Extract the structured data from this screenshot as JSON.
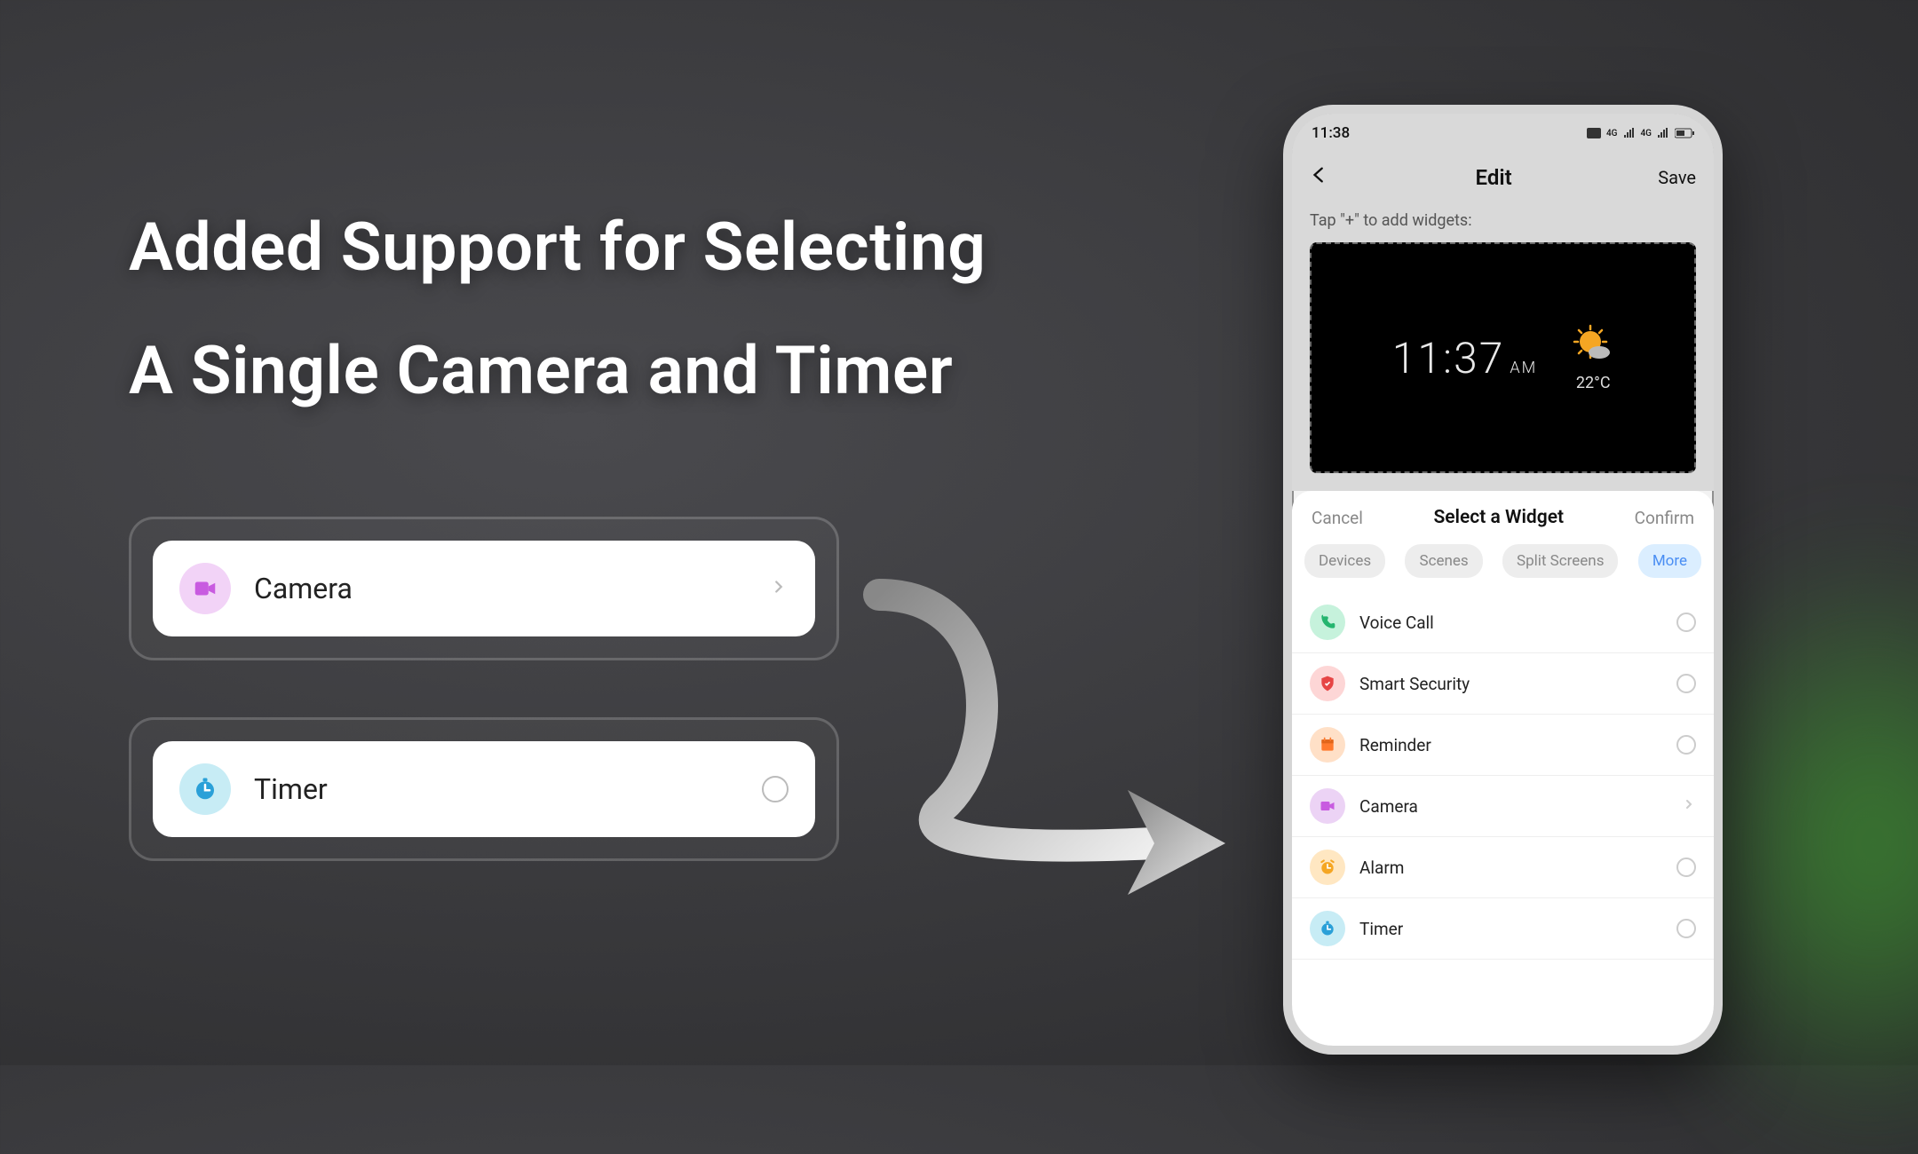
{
  "headline": {
    "line1": "Added Support for Selecting",
    "line2": "A Single Camera and Timer"
  },
  "feature_cards": {
    "camera": {
      "label": "Camera"
    },
    "timer": {
      "label": "Timer"
    }
  },
  "phone": {
    "status_time": "11:38",
    "nav": {
      "title": "Edit",
      "save": "Save"
    },
    "hint": "Tap \"+\" to add widgets:",
    "preview": {
      "time": "11:37",
      "ampm": "AM",
      "temp": "22°C"
    },
    "sheet": {
      "cancel": "Cancel",
      "title": "Select a Widget",
      "confirm": "Confirm",
      "tabs": {
        "devices": "Devices",
        "scenes": "Scenes",
        "split": "Split Screens",
        "more": "More"
      },
      "items": [
        {
          "label": "Voice Call"
        },
        {
          "label": "Smart Security"
        },
        {
          "label": "Reminder"
        },
        {
          "label": "Camera"
        },
        {
          "label": "Alarm"
        },
        {
          "label": "Timer"
        }
      ]
    }
  }
}
